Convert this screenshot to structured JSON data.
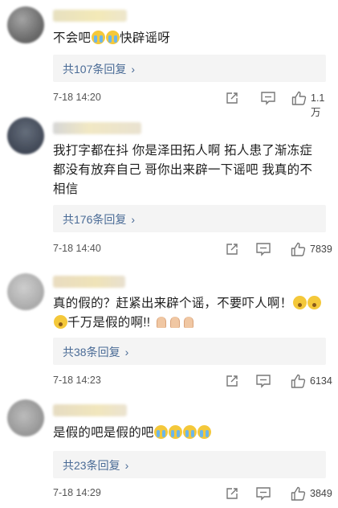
{
  "comments": [
    {
      "text": "不会吧",
      "text_after": "快辟谣呀",
      "emojis": [
        "crying-face",
        "crying-face"
      ],
      "replies": "共107条回复",
      "time": "7-18 14:20",
      "likes": "1.1万"
    },
    {
      "text": "我打字都在抖  你是泽田拓人啊  拓人患了渐冻症都没有放弃自己  哥你出来辟一下谣吧  我真的不相信",
      "replies": "共176条回复",
      "time": "7-18 14:40",
      "likes": "7839"
    },
    {
      "text": "真的假的？赶紧出来辟个谣，不要吓人啊！",
      "text_after": "千万是假的啊!!",
      "replies": "共38条回复",
      "time": "7-18 14:23",
      "likes": "6134"
    },
    {
      "text": "是假的吧是假的吧",
      "emojis": [
        "crying-face",
        "crying-face",
        "crying-face",
        "crying-face"
      ],
      "replies": "共23条回复",
      "time": "7-18 14:29",
      "likes": "3849"
    }
  ],
  "reply_chevron": "›",
  "colors": {
    "link": "#4a6b96",
    "reply_bg": "#f4f4f4",
    "meta_text": "#555555"
  }
}
